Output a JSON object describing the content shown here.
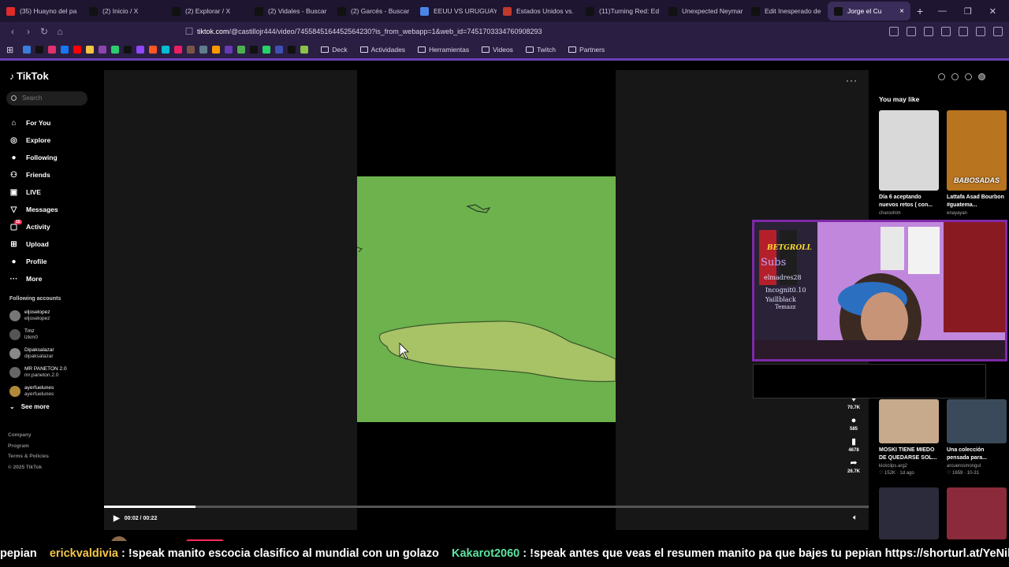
{
  "browser": {
    "tabs": [
      {
        "label": "(35) Huayno del pa",
        "color": "#e02b2b"
      },
      {
        "label": "(2) Inicio / X",
        "color": "#111111"
      },
      {
        "label": "(2) Explorar / X",
        "color": "#111111"
      },
      {
        "label": "(2) Vidales - Buscar",
        "color": "#111111"
      },
      {
        "label": "(2) Garcés - Buscar",
        "color": "#111111"
      },
      {
        "label": "EEUU VS URUGUAY",
        "color": "#4a86e8"
      },
      {
        "label": "Estados Unidos vs.",
        "color": "#c0392b"
      },
      {
        "label": "(11)Turning Red: Ed",
        "color": "#111111"
      },
      {
        "label": "Unexpected Neymar",
        "color": "#111111"
      },
      {
        "label": "Edit Inesperado de",
        "color": "#111111"
      },
      {
        "label": "Jorge el Cu",
        "color": "#111111",
        "active": true
      }
    ],
    "new_tab": "+",
    "url_prefix": "tiktok.com",
    "url_rest": "/@castillojr444/video/7455845164452564230?is_from_webapp=1&web_id=7451703334760908293",
    "bookmarks": [
      "Deck",
      "Actividades",
      "Herramientas",
      "Videos",
      "Twitch",
      "Partners"
    ],
    "bookmark_icon_colors": [
      "#3b7ddd",
      "#111111",
      "#e1306c",
      "#1877f2",
      "#ff0000",
      "#f4c542",
      "#8e44ad",
      "#2ecc71",
      "#111111",
      "#9146ff",
      "#ff5722",
      "#00bcd4",
      "#e91e63",
      "#795548",
      "#607d8b",
      "#ff9800",
      "#673ab7",
      "#4caf50",
      "#111111",
      "#25d366",
      "#3f51b5",
      "#111111",
      "#8bc34a"
    ]
  },
  "tiktok": {
    "logo": "TikTok",
    "search_placeholder": "Search",
    "nav": [
      {
        "label": "For You",
        "icon": "home-icon",
        "glyph": "⌂"
      },
      {
        "label": "Explore",
        "icon": "compass-icon",
        "glyph": "◎"
      },
      {
        "label": "Following",
        "icon": "avatar-icon",
        "glyph": "●"
      },
      {
        "label": "Friends",
        "icon": "friends-icon",
        "glyph": "⚇"
      },
      {
        "label": "LIVE",
        "icon": "live-icon",
        "glyph": "▣"
      },
      {
        "label": "Messages",
        "icon": "messages-icon",
        "glyph": "▽"
      },
      {
        "label": "Activity",
        "icon": "activity-icon",
        "glyph": "▢",
        "badge": "15"
      },
      {
        "label": "Upload",
        "icon": "upload-icon",
        "glyph": "⊞"
      },
      {
        "label": "Profile",
        "icon": "profile-icon",
        "glyph": "●"
      },
      {
        "label": "More",
        "icon": "more-icon",
        "glyph": "···"
      }
    ],
    "following_title": "Following accounts",
    "following": [
      {
        "name": "eljoselopez",
        "user": "eljoselopez",
        "color": "#777"
      },
      {
        "name": "Tmz",
        "user": "lzkm0",
        "color": "#555"
      },
      {
        "name": "Dipaksalazar",
        "user": "dipaksalazar",
        "color": "#888"
      },
      {
        "name": "MR PANETON 2.0",
        "user": "mr.paneton.2.0",
        "color": "#666"
      },
      {
        "name": "ayerfuelunes",
        "user": "ayerfuelunes",
        "color": "#b08a3a"
      }
    ],
    "see_more": "See more",
    "footer": [
      "Company",
      "Program",
      "Terms & Policies",
      "© 2025 TikTok"
    ],
    "player": {
      "time": "00:02 / 00:22",
      "progress": 0.12,
      "likes": "70.7K",
      "comments": "585",
      "saves": "4678",
      "shares": "26.7K",
      "author": "castillojr444"
    },
    "you_may_like": "You may like",
    "recommended": [
      {
        "title": "Día 6 aceptando nuevos retos ( con...",
        "meta": "charoshim",
        "bg": "#d9d9d9"
      },
      {
        "title": "Lattafa Asad Bourbon #guatema...",
        "meta": "enayayan",
        "bg": "#b9741f",
        "label": "BABOSADAS"
      },
      {
        "title": "MOSKI TIENE MIEDO DE QUEDARSE SOL...",
        "meta": "kickclips.arg2",
        "meta2": "♡ 152K · 1d ago",
        "bg": "#c7a98b"
      },
      {
        "title": "Una colección pensada para...",
        "meta": "arcuerosmongul",
        "meta2": "♡ 1659 · 10-31",
        "bg": "#3a4a5a"
      },
      {
        "title": "",
        "meta": "",
        "bg": "#2b2b3b"
      },
      {
        "title": "",
        "meta": "",
        "bg": "#8a2a3a"
      }
    ]
  },
  "stream_overlay": {
    "cam_lines": [
      "BETGROLL",
      "Subs",
      "elmadres28",
      "Incognit0.10",
      "Yaillblack",
      "Temazz"
    ]
  },
  "chat_ticker": {
    "lead": "pepian",
    "user1": "erickvaldivia",
    "msg1": ": !speak manito escocia clasifico al mundial con un golazo",
    "user2": "Kakarot2060",
    "msg2": ": !speak antes que veas el resumen manito pa que bajes tu pepian https://shorturl.at/YeNil"
  }
}
